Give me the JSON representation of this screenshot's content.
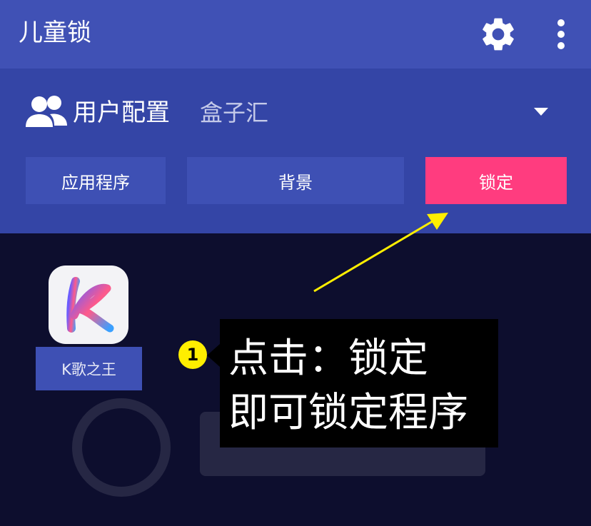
{
  "appbar": {
    "title": "儿童锁",
    "settings_icon": "gear-icon",
    "more_icon": "more-vert-icon"
  },
  "profile": {
    "icon": "people-icon",
    "label": "用户配置",
    "selected": "盒子汇"
  },
  "tabs": {
    "apps_label": "应用程序",
    "background_label": "背景",
    "lock_label": "锁定"
  },
  "apps": [
    {
      "name": "K歌之王",
      "icon": "karaoke-k-icon"
    }
  ],
  "annotation": {
    "step_number": "1",
    "line1": "点击：锁定",
    "line2": "即可锁定程序"
  },
  "colors": {
    "appbar": "#4051b5",
    "panel": "#3445a6",
    "button": "#3e50b4",
    "lock_button": "#ff3c7f",
    "background": "#0d0e2e",
    "annotation_arrow": "#ffee00"
  }
}
